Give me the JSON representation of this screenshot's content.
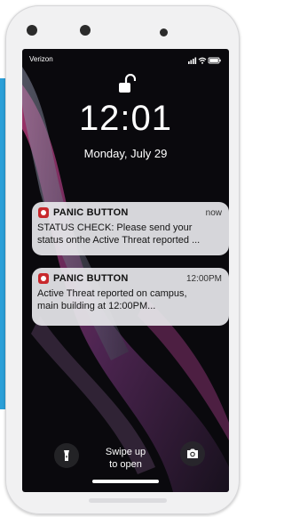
{
  "status_bar": {
    "carrier": "Verizon",
    "icons": [
      "cellular-signal-icon",
      "wifi-icon",
      "battery-icon"
    ]
  },
  "lock_screen": {
    "lock_icon": "unlocked-padlock-icon",
    "time": "12:01",
    "date": "Monday, July 29"
  },
  "notifications": [
    {
      "app_icon": "panic-button-app-icon",
      "app_name": "PANIC BUTTON",
      "time": "now",
      "body": "STATUS CHECK: Please send your\nstatus onthe Active Threat reported ..."
    },
    {
      "app_icon": "panic-button-app-icon",
      "app_name": "PANIC BUTTON",
      "time": "12:00PM",
      "body": "Active Threat reported on campus,\nmain building at 12:00PM..."
    }
  ],
  "bottom": {
    "flashlight_icon": "flashlight-icon",
    "camera_icon": "camera-icon",
    "swipe_text": "Swipe up\nto open"
  },
  "colors": {
    "side_accent": "#2a9fd8",
    "app_icon_red": "#c8282c",
    "screen_background": "#0a090d"
  }
}
